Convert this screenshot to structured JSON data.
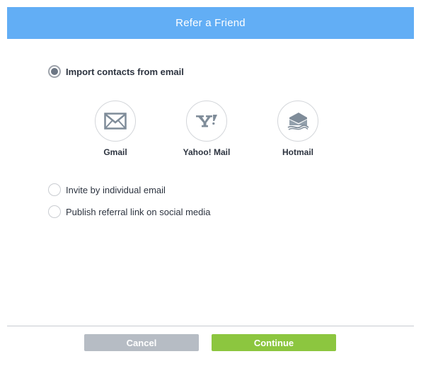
{
  "header": {
    "title": "Refer a Friend"
  },
  "options": {
    "import": {
      "label": "Import contacts from email",
      "selected": true
    },
    "individual": {
      "label": "Invite by individual email",
      "selected": false
    },
    "social": {
      "label": "Publish referral link on social media",
      "selected": false
    }
  },
  "providers": [
    {
      "label": "Gmail",
      "icon": "envelope-icon"
    },
    {
      "label": "Yahoo! Mail",
      "icon": "yahoo-icon"
    },
    {
      "label": "Hotmail",
      "icon": "hotmail-icon"
    }
  ],
  "footer": {
    "cancel_label": "Cancel",
    "continue_label": "Continue"
  },
  "colors": {
    "header": "#62aef5",
    "continue": "#8cc63f",
    "cancel": "#b6bcc4",
    "icon": "#7f8c99"
  }
}
